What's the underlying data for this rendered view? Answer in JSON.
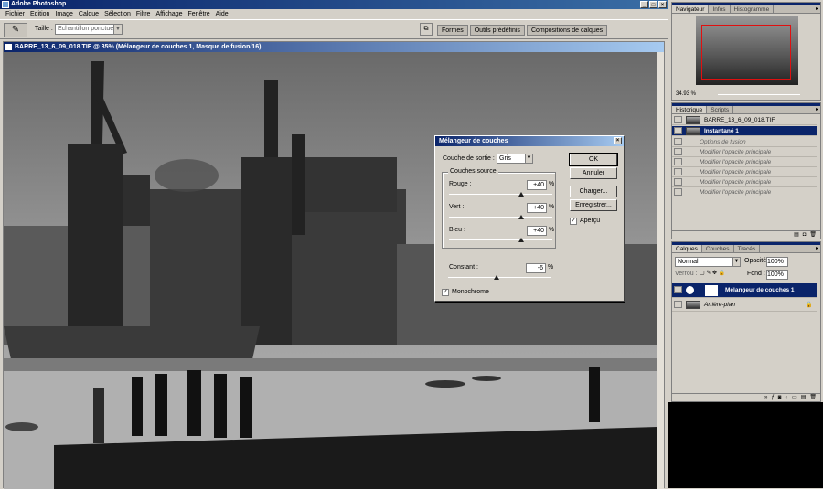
{
  "app": {
    "title": "Adobe Photoshop"
  },
  "menu": [
    "Fichier",
    "Edition",
    "Image",
    "Calque",
    "Sélection",
    "Filtre",
    "Affichage",
    "Fenêtre",
    "Aide"
  ],
  "options": {
    "size_label": "Taille :",
    "size_value": "Echantillon ponctuel",
    "palette_well": [
      "Formes",
      "Outils prédéfinis",
      "Compositions de calques"
    ]
  },
  "document": {
    "title": "BARRE_13_6_09_018.TIF @ 35% (Mélangeur de couches 1, Masque de fusion/16)"
  },
  "dialog": {
    "title": "Mélangeur de couches",
    "output_label": "Couche de sortie :",
    "output_value": "Gris",
    "source_group": "Couches source",
    "red_label": "Rouge :",
    "red_value": "+40",
    "red_pct": "%",
    "red_level": 0.7,
    "green_label": "Vert :",
    "green_value": "+40",
    "green_pct": "%",
    "green_level": 0.7,
    "blue_label": "Bleu :",
    "blue_value": "+40",
    "blue_pct": "%",
    "blue_level": 0.7,
    "constant_label": "Constant :",
    "constant_value": "-6",
    "constant_pct": "%",
    "constant_level": 0.47,
    "mono_label": "Monochrome",
    "mono_checked": true,
    "ok": "OK",
    "cancel": "Annuler",
    "load": "Charger...",
    "save": "Enregistrer...",
    "preview_label": "Aperçu",
    "preview_checked": true
  },
  "navigator": {
    "tabs": [
      "Navigateur",
      "Infos",
      "Histogramme"
    ],
    "zoom": "34.93 %"
  },
  "history": {
    "tabs": [
      "Historique",
      "Scripts"
    ],
    "snapshot_file": "BARRE_13_6_09_018.TIF",
    "snapshot": "Instantané 1",
    "steps": [
      "Options de fusion",
      "Modifier l'opacité principale",
      "Modifier l'opacité principale",
      "Modifier l'opacité principale",
      "Modifier l'opacité principale",
      "Modifier l'opacité principale"
    ]
  },
  "layers": {
    "tabs": [
      "Calques",
      "Couches",
      "Tracés"
    ],
    "blend_mode": "Normal",
    "opacity_label": "Opacité:",
    "opacity": "100%",
    "lock_label": "Verrou :",
    "fill_label": "Fond :",
    "fill": "100%",
    "items": [
      {
        "name": "Mélangeur de couches 1"
      },
      {
        "name": "Arrière-plan"
      }
    ]
  }
}
